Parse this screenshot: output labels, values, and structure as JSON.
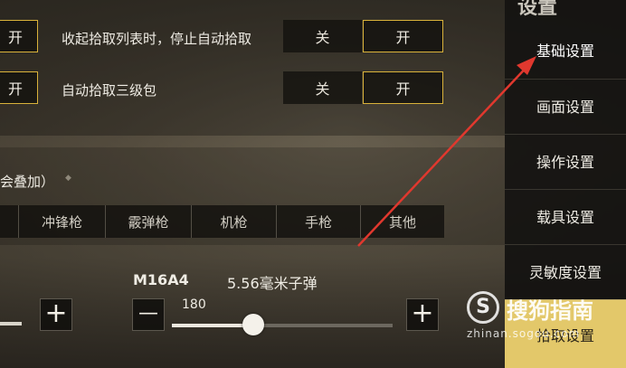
{
  "sidebar": {
    "title": "设置",
    "items": [
      {
        "label": "基础设置"
      },
      {
        "label": "画面设置"
      },
      {
        "label": "操作设置"
      },
      {
        "label": "载具设置"
      },
      {
        "label": "灵敏度设置"
      },
      {
        "label": "拾取设置"
      }
    ]
  },
  "rows": [
    {
      "label": "收起拾取列表时，停止自动拾取",
      "off": "关",
      "on": "开",
      "left_on": "开"
    },
    {
      "label": "自动拾取三级包",
      "off": "关",
      "on": "开",
      "left_on": "开"
    }
  ],
  "section": {
    "title": "会叠加）",
    "marker": "◆"
  },
  "weapon_tabs": [
    "冲锋枪",
    "霰弹枪",
    "机枪",
    "手枪",
    "其他"
  ],
  "weapon": {
    "name": "M16A4",
    "ammo": "5.56毫米子弹",
    "count": "180",
    "slider_fraction": 0.37,
    "minus": "—",
    "plus": "+"
  },
  "watermark": {
    "brand": "搜狗指南",
    "url": "zhinan.sogou.com"
  },
  "colors": {
    "accent": "#d9b23a",
    "arrow": "#e0382e",
    "selected": "#e3c86a"
  }
}
